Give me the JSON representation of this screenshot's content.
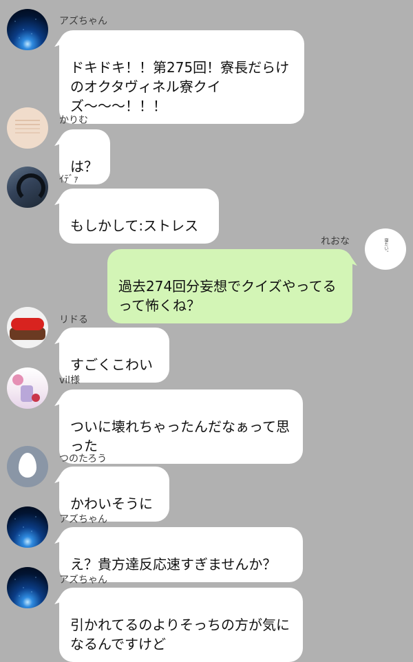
{
  "messages": [
    {
      "sender": "アズちゃん",
      "text": "ドキドキ！！第275回！寮長だらけのオクタヴィネル寮クイズ〜〜〜！！！",
      "side": "left"
    },
    {
      "sender": "かりむ",
      "text": "は？",
      "side": "left"
    },
    {
      "sender": "ｲﾃﾞｧ",
      "text": "もしかして:ストレス",
      "side": "left"
    },
    {
      "sender": "れおな",
      "text": "過去274回分妄想でクイズやってるって怖くね？",
      "side": "right"
    },
    {
      "sender": "リドる",
      "text": "すごくこわい",
      "side": "left"
    },
    {
      "sender": "vil様",
      "text": "ついに壊れちゃったんだなぁって思った",
      "side": "left"
    },
    {
      "sender": "つのたろう",
      "text": "かわいそうに",
      "side": "left"
    },
    {
      "sender": "アズちゃん",
      "text": "え？貴方達反応速すぎませんか？",
      "side": "left"
    },
    {
      "sender": "アズちゃん",
      "text": "引かれてるのよりそっちの方が気になるんですけど",
      "side": "left"
    }
  ],
  "avatar_text": {
    "reona": "寝たい。"
  },
  "colors": {
    "background": "#b1b1b1",
    "bubble_left": "#ffffff",
    "bubble_right": "#d3f5b6"
  }
}
